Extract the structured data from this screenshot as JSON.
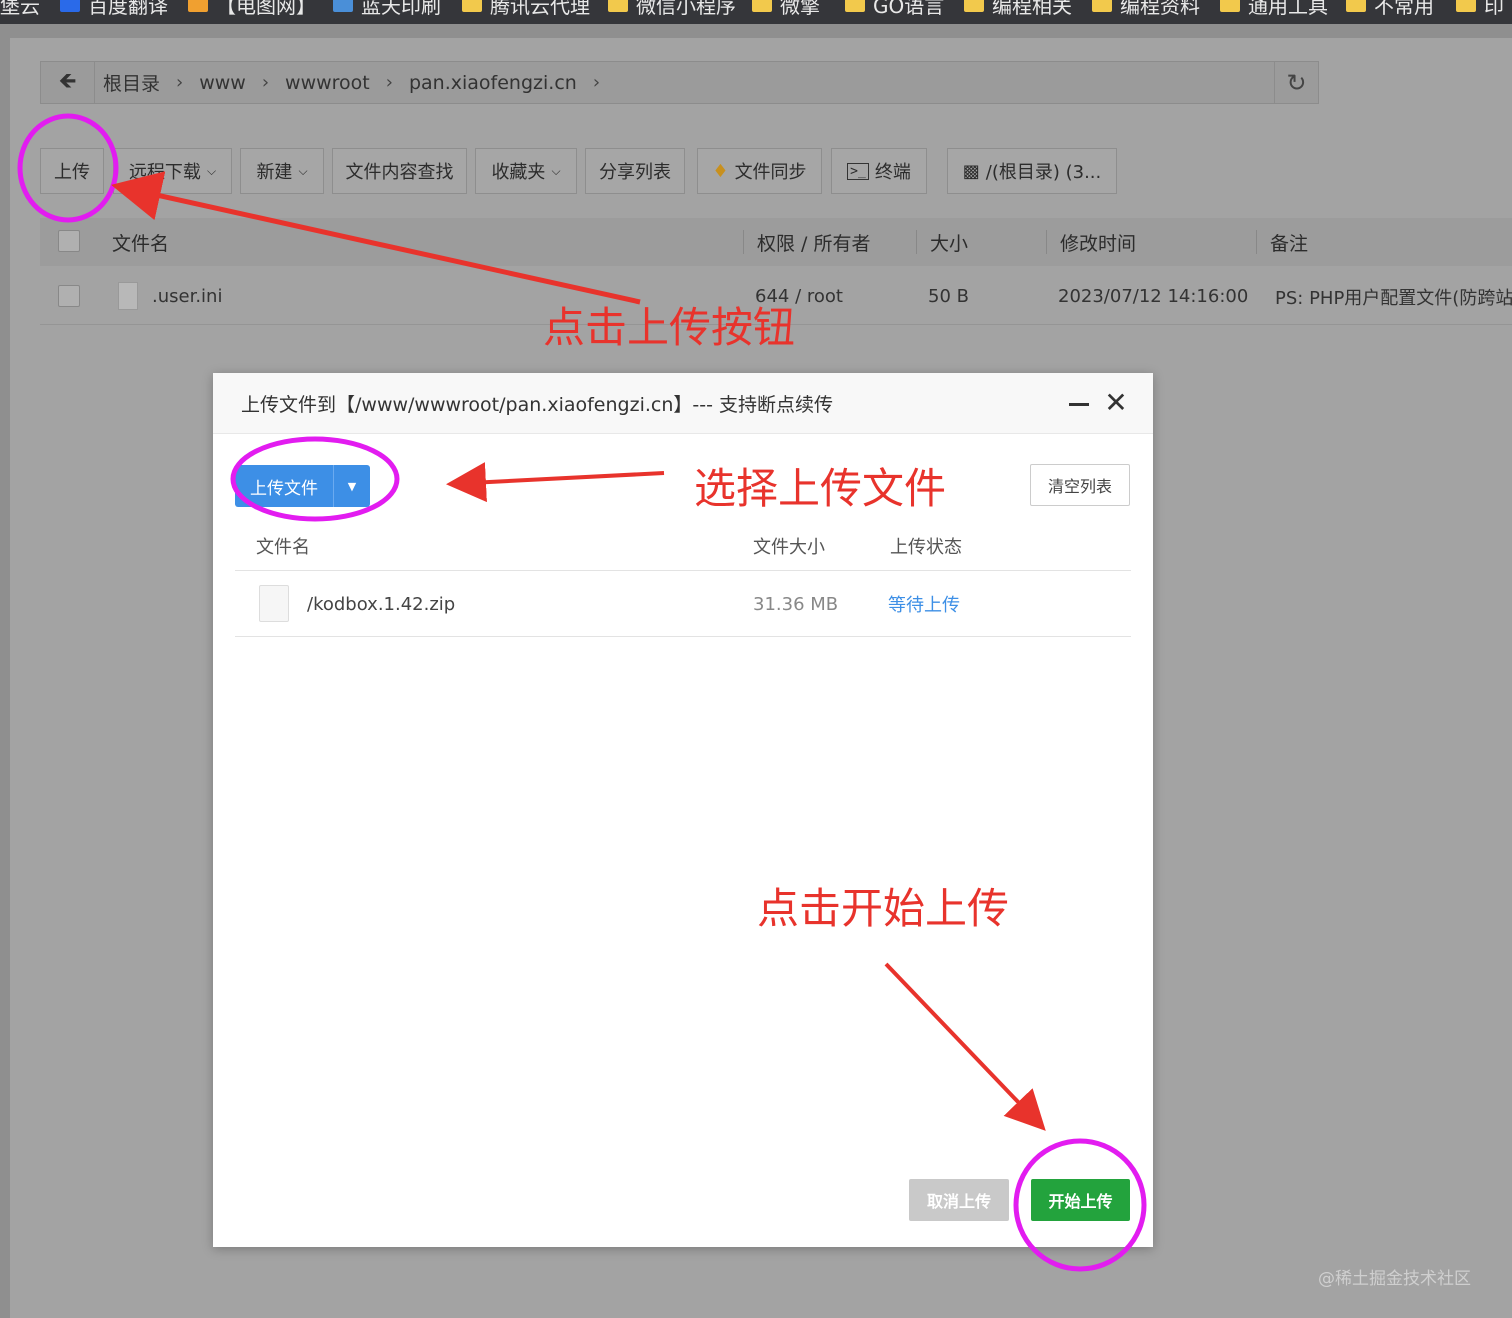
{
  "bookmarks": [
    {
      "label": "堡云",
      "icon_color": "#3b78e7"
    },
    {
      "label": "百度翻译",
      "icon_color": "#2a6ae9"
    },
    {
      "label": "【电图网】",
      "icon_color": "#f0a030"
    },
    {
      "label": "蓝天印刷",
      "icon_color": "#4a8fd8"
    },
    {
      "label": "腾讯云代理",
      "icon_color": "#f2c94c"
    },
    {
      "label": "微信小程序",
      "icon_color": "#f2c94c"
    },
    {
      "label": "微擎",
      "icon_color": "#f2c94c"
    },
    {
      "label": "GO语言",
      "icon_color": "#f2c94c"
    },
    {
      "label": "编程相关",
      "icon_color": "#f2c94c"
    },
    {
      "label": "编程资料",
      "icon_color": "#f2c94c"
    },
    {
      "label": "通用工具",
      "icon_color": "#f2c94c"
    },
    {
      "label": "不常用",
      "icon_color": "#f2c94c"
    },
    {
      "label": "印",
      "icon_color": "#f2c94c"
    }
  ],
  "address_bar": {
    "back_icon": "arrow-left-icon",
    "crumbs": [
      "根目录",
      "www",
      "wwwroot",
      "pan.xiaofengzi.cn"
    ],
    "separator": "›",
    "refresh_icon": "refresh-icon"
  },
  "toolbar": {
    "upload": "上传",
    "remote_download": "远程下载",
    "new": "新建",
    "content_search": "文件内容查找",
    "favorites": "收藏夹",
    "share_list": "分享列表",
    "file_sync": "文件同步",
    "terminal": "终端",
    "disk": "/(根目录) (3..."
  },
  "file_table": {
    "headers": {
      "name": "文件名",
      "perm": "权限 / 所有者",
      "size": "大小",
      "mtime": "修改时间",
      "remark": "备注"
    },
    "rows": [
      {
        "name": ".user.ini",
        "perm": "644 / root",
        "size": "50 B",
        "mtime": "2023/07/12 14:16:00",
        "remark": "PS: PHP用户配置文件(防跨站)!"
      }
    ]
  },
  "upload_dialog": {
    "title": "上传文件到【/www/wwwroot/pan.xiaofengzi.cn】--- 支持断点续传",
    "upload_files_label": "上传文件",
    "clear_list_label": "清空列表",
    "headers": {
      "name": "文件名",
      "size": "文件大小",
      "status": "上传状态"
    },
    "files": [
      {
        "name": "/kodbox.1.42.zip",
        "size": "31.36 MB",
        "status": "等待上传"
      }
    ],
    "cancel_label": "取消上传",
    "start_label": "开始上传",
    "status_color": "#3d8fe6",
    "start_color": "#23a33d"
  },
  "annotations": {
    "click_upload": "点击上传按钮",
    "choose_file": "选择上传文件",
    "click_start": "点击开始上传",
    "arrow_color": "#e8332c",
    "circle_color": "#e21cf0"
  },
  "watermark": "@稀土掘金技术社区"
}
